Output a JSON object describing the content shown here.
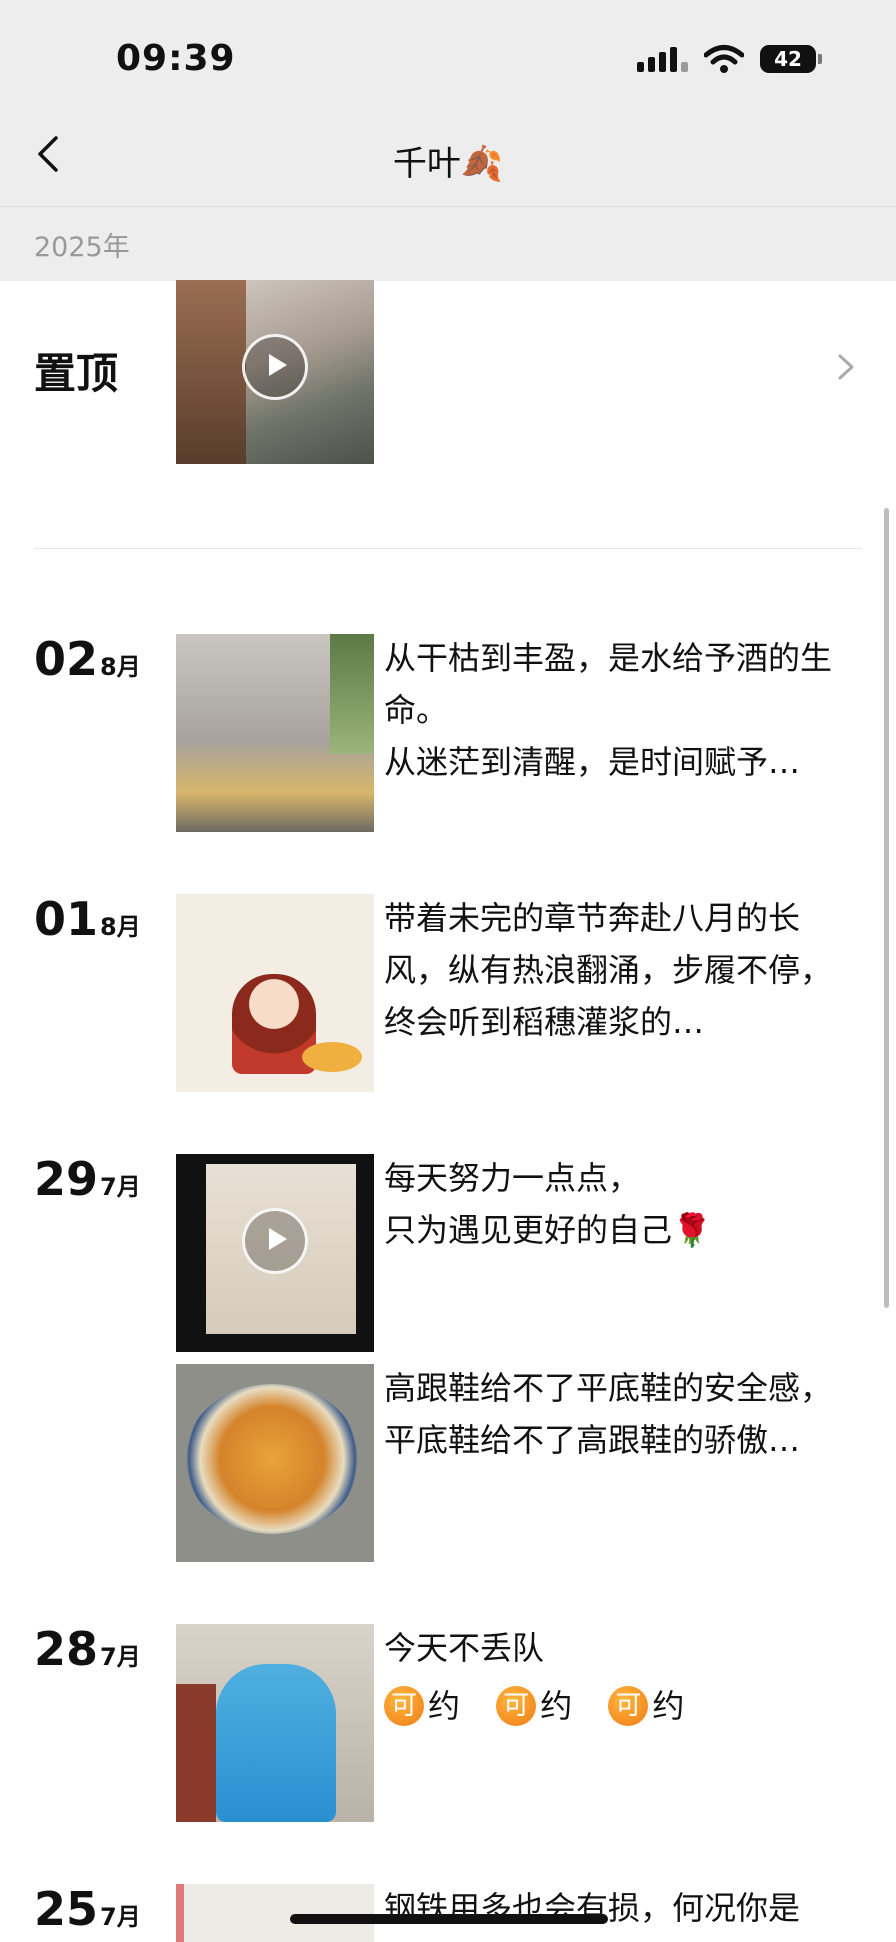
{
  "status": {
    "time": "09:39",
    "battery": "42"
  },
  "nav": {
    "title": "千叶🍂"
  },
  "year": "2025年",
  "pinned": {
    "label": "置顶"
  },
  "posts": [
    {
      "day": "02",
      "month": "8月",
      "text": "从干枯到丰盈，是水给予酒的生命。\n从迷茫到清醒，是时间赋予…"
    },
    {
      "day": "01",
      "month": "8月",
      "text": "带着未完的章节奔赴八月的长风，纵有热浪翻涌，步履不停，终会听到稻穗灌浆的…"
    },
    {
      "day": "29",
      "month": "7月",
      "text": "每天努力一点点，\n只为遇见更好的自己🌹",
      "text2": "高跟鞋给不了平底鞋的安全感，\n平底鞋给不了高跟鞋的骄傲…"
    },
    {
      "day": "28",
      "month": "7月",
      "text": "今天不丢队",
      "badges": [
        {
          "mark": "可",
          "word": "约"
        },
        {
          "mark": "可",
          "word": "约"
        },
        {
          "mark": "可",
          "word": "约"
        }
      ]
    },
    {
      "day": "25",
      "month": "7月",
      "text": "钢铁用多也会有损，何况你是一..."
    }
  ],
  "icons": {
    "back": "chevron-left-icon",
    "more": "chevron-right-icon",
    "play": "play-icon",
    "wifi": "wifi-icon",
    "signal": "signal-icon"
  }
}
